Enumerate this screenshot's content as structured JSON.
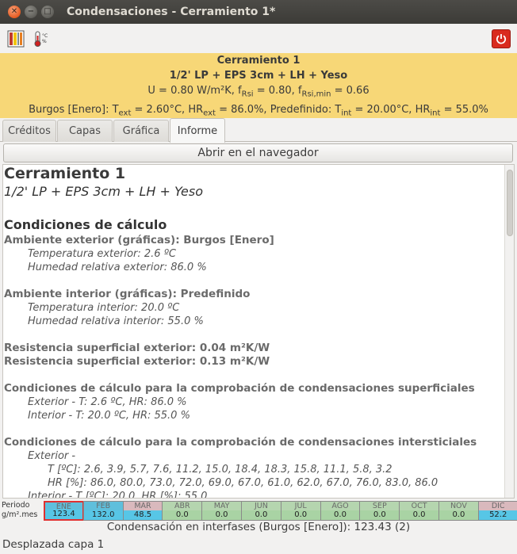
{
  "window": {
    "title": "Condensaciones - Cerramiento 1*"
  },
  "banner": {
    "name": "Cerramiento 1",
    "layers": "1/2' LP + EPS 3cm + LH + Yeso",
    "u_text": "U = 0.80 W/m²K, f",
    "frsi_sub": "Rsi",
    "frsi_val": " = 0.80, f",
    "frsimin_sub": "Rsi,min",
    "frsimin_val": " = 0.66",
    "clim_a": "Burgos [Enero]: T",
    "text_sub": "ext",
    "clim_b": " = 2.60°C, HR",
    "hrext_sub": "ext",
    "clim_c": " = 86.0%, Predefinido: T",
    "tint_sub": "int",
    "clim_d": " = 20.00°C, HR",
    "hrint_sub": "int",
    "clim_e": " = 55.0%"
  },
  "tabs": [
    "Créditos",
    "Capas",
    "Gráfica",
    "Informe"
  ],
  "browser_button": "Abrir en el navegador",
  "report": {
    "title": "Cerramiento 1",
    "subtitle": "1/2' LP + EPS 3cm + LH + Yeso",
    "section": "Condiciones de cálculo",
    "ext_amb": "Ambiente exterior (gráficas): Burgos [Enero]",
    "ext_temp": "Temperatura exterior: 2.6 ºC",
    "ext_hr": "Humedad relativa exterior: 86.0 %",
    "int_amb": "Ambiente interior (gráficas): Predefinido",
    "int_temp": "Temperatura interior: 20.0 ºC",
    "int_hr": "Humedad relativa interior: 55.0 %",
    "rse": "Resistencia superficial exterior: 0.04 m²K/W",
    "rsi": "Resistencia superficial exterior: 0.13 m²K/W",
    "sup_title": "Condiciones de cálculo para la comprobación de condensaciones superficiales",
    "sup_ext": "Exterior - T: 2.6 ºC, HR: 86.0 %",
    "sup_int": "Interior - T: 20.0 ºC, HR: 55.0 %",
    "inters_title": "Condiciones de cálculo para la comprobación de condensaciones intersticiales",
    "inters_ext": "Exterior -",
    "inters_t": "T [ºC]: 2.6, 3.9, 5.7, 7.6, 11.2, 15.0, 18.4, 18.3, 15.8, 11.1, 5.8, 3.2",
    "inters_hr": "HR [%]: 86.0, 80.0, 73.0, 72.0, 69.0, 67.0, 61.0, 62.0, 67.0, 76.0, 83.0, 86.0",
    "inters_int": "Interior - T [ºC]: 20.0, HR [%]: 55.0"
  },
  "period": {
    "label1": "Periodo",
    "label2": "g/m².mes"
  },
  "months": [
    {
      "name": "ENE",
      "value": "123.4",
      "color": "#57c6e6",
      "selected": true
    },
    {
      "name": "FEB",
      "value": "132.0",
      "color": "#57c6e6",
      "selected": false
    },
    {
      "name": "MAR",
      "value": "48.5",
      "color": "#57c6e6",
      "selected": false
    },
    {
      "name": "ABR",
      "value": "0.0",
      "color": "#a9d3a4",
      "selected": false
    },
    {
      "name": "MAY",
      "value": "0.0",
      "color": "#a9d3a4",
      "selected": false
    },
    {
      "name": "JUN",
      "value": "0.0",
      "color": "#a9d3a4",
      "selected": false
    },
    {
      "name": "JUL",
      "value": "0.0",
      "color": "#a9d3a4",
      "selected": false
    },
    {
      "name": "AGO",
      "value": "0.0",
      "color": "#a9d3a4",
      "selected": false
    },
    {
      "name": "SEP",
      "value": "0.0",
      "color": "#a9d3a4",
      "selected": false
    },
    {
      "name": "OCT",
      "value": "0.0",
      "color": "#a9d3a4",
      "selected": false
    },
    {
      "name": "NOV",
      "value": "0.0",
      "color": "#a9d3a4",
      "selected": false
    },
    {
      "name": "DIC",
      "value": "52.2",
      "color": "#57c6e6",
      "selected": false
    }
  ],
  "summary": "Condensación en interfases (Burgos [Enero]): 123.43 (2)",
  "status": "Desplazada capa 1"
}
